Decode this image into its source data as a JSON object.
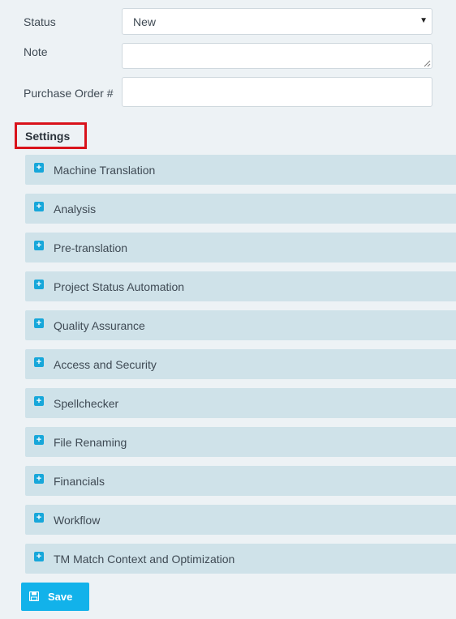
{
  "form": {
    "status_label": "Status",
    "status_value": "New",
    "note_label": "Note",
    "note_value": "",
    "po_label": "Purchase Order #",
    "po_value": ""
  },
  "settings": {
    "heading": "Settings",
    "sections": [
      "Machine Translation",
      "Analysis",
      "Pre-translation",
      "Project Status Automation",
      "Quality Assurance",
      "Access and Security",
      "Spellchecker",
      "File Renaming",
      "Financials",
      "Workflow",
      "TM Match Context and Optimization"
    ]
  },
  "actions": {
    "save_label": "Save"
  },
  "colors": {
    "accent": "#12b2ea",
    "highlight_border": "#d9131b",
    "section_bg": "#cfe2e9",
    "page_bg": "#edf2f5"
  },
  "icons": {
    "expand": "plus-square-icon",
    "save": "floppy-disk-icon",
    "dropdown": "caret-down-icon"
  }
}
